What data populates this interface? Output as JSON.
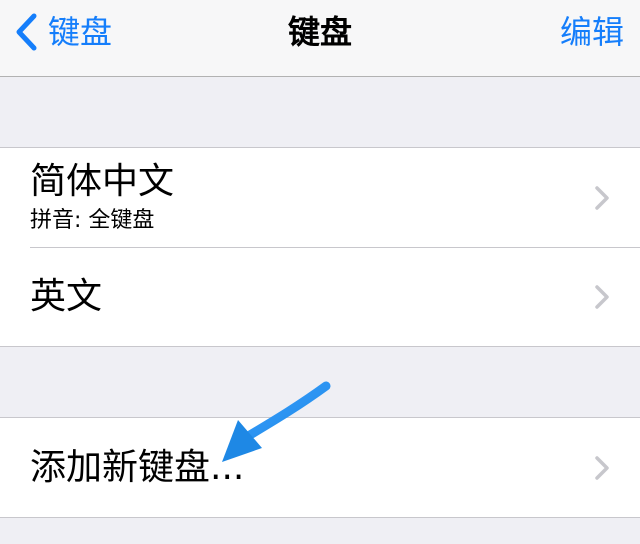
{
  "navbar": {
    "back_label": "键盘",
    "title": "键盘",
    "edit_label": "编辑"
  },
  "keyboards": [
    {
      "title": "简体中文",
      "subtitle": "拼音: 全键盘"
    },
    {
      "title": "英文"
    }
  ],
  "add_keyboard": {
    "label": "添加新键盘..."
  },
  "colors": {
    "accent": "#157efb",
    "arrow": "#2196f3"
  },
  "icons": [
    "back-chevron-icon",
    "chevron-right-icon",
    "arrow-annotation"
  ]
}
